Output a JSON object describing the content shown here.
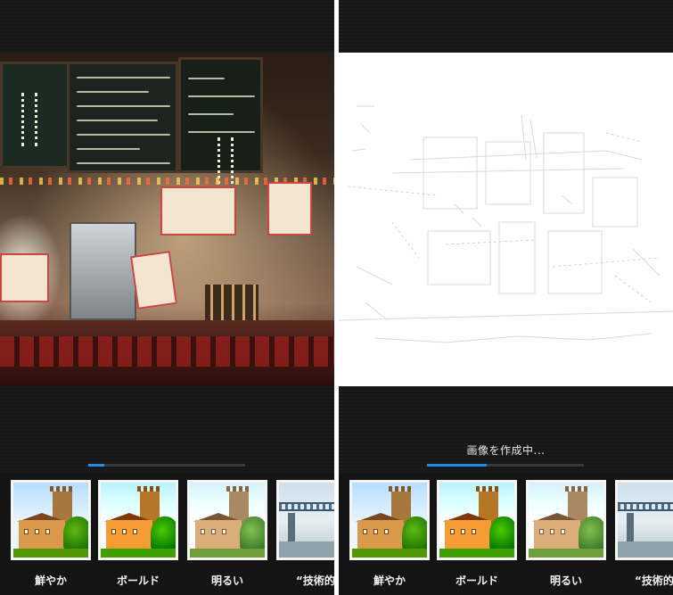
{
  "left_panel": {
    "filters": [
      {
        "label": "鮮やか",
        "selected": true
      },
      {
        "label": "ボールド",
        "selected": false
      },
      {
        "label": "明るい",
        "selected": false
      },
      {
        "label": "“技術的な",
        "selected": false
      }
    ],
    "progress": 0.1
  },
  "right_panel": {
    "status": "画像を作成中...",
    "filters": [
      {
        "label": "鮮やか",
        "selected": true
      },
      {
        "label": "ボールド",
        "selected": false
      },
      {
        "label": "明るい",
        "selected": false
      },
      {
        "label": "“技術的な",
        "selected": false
      }
    ],
    "progress": 0.38
  },
  "colors": {
    "accent": "#1e8fe6",
    "background": "#1b1b1b",
    "label": "#f2f2f2"
  },
  "icons": {
    "selection_indicator": "pill-indicator"
  }
}
